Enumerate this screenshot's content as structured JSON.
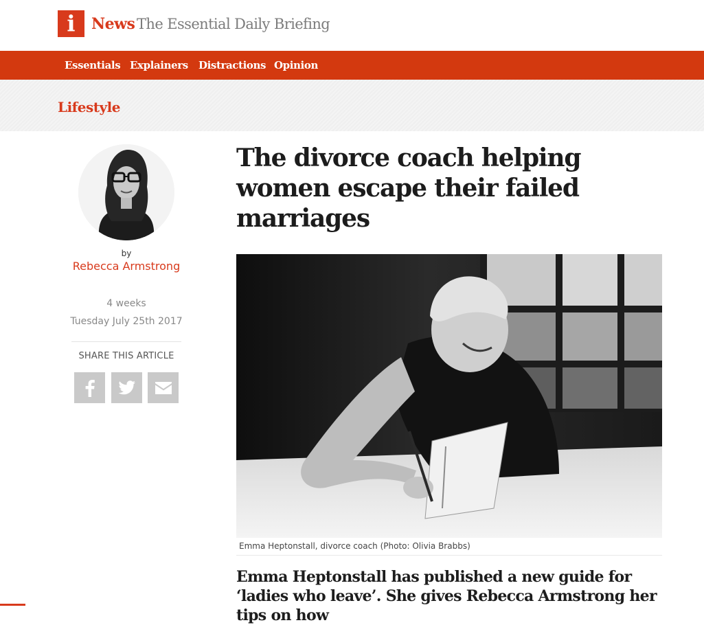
{
  "brand": {
    "logo_letter": "i",
    "name": "News",
    "tagline": "The Essential Daily Briefing",
    "accent_color": "#d83a1c"
  },
  "nav": {
    "items": [
      "Essentials",
      "Explainers",
      "Distractions",
      "Opinion"
    ]
  },
  "section": {
    "title": "Lifestyle"
  },
  "author": {
    "by_label": "by",
    "name": "Rebecca Armstrong",
    "time_ago": "4 weeks",
    "date": "Tuesday July 25th 2017"
  },
  "share": {
    "label": "SHARE THIS ARTICLE",
    "buttons": [
      "facebook-icon",
      "twitter-icon",
      "email-icon"
    ]
  },
  "article": {
    "headline": "The divorce coach helping women escape their failed marriages",
    "image_caption": "Emma Heptonstall, divorce coach (Photo: Olivia Brabbs)",
    "standfirst": "Emma Heptonstall has published a new guide for ‘ladies who leave’. She gives Rebecca Armstrong her tips on how"
  }
}
